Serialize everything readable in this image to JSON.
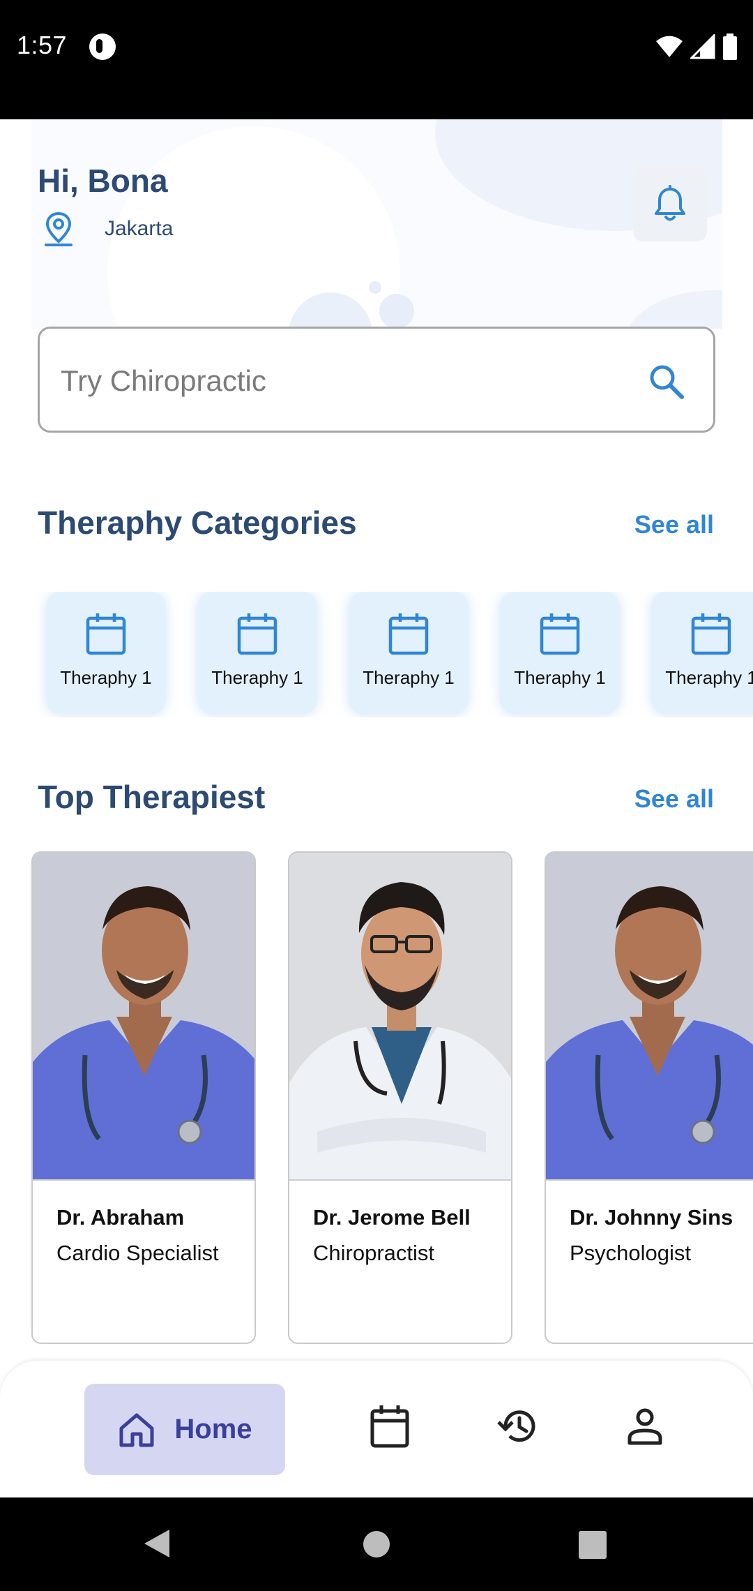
{
  "status_bar": {
    "time": "1:57"
  },
  "header": {
    "greeting": "Hi, Bona",
    "location": "Jakarta"
  },
  "search": {
    "placeholder": "Try Chiropractic"
  },
  "categories_section": {
    "title": "Theraphy Categories",
    "see_all": "See all",
    "items": [
      {
        "label": "Theraphy 1",
        "icon": "calendar-icon"
      },
      {
        "label": "Theraphy 1",
        "icon": "calendar-icon"
      },
      {
        "label": "Theraphy 1",
        "icon": "calendar-icon"
      },
      {
        "label": "Theraphy 1",
        "icon": "calendar-icon"
      },
      {
        "label": "Theraphy 1",
        "icon": "calendar-icon"
      }
    ]
  },
  "therapists_section": {
    "title": "Top Therapiest",
    "see_all": "See all",
    "doctors": [
      {
        "name": "Dr. Abraham",
        "specialty": "Cardio Specialist"
      },
      {
        "name": "Dr. Jerome Bell",
        "specialty": "Chiropractist"
      },
      {
        "name": "Dr. Johnny Sins",
        "specialty": "Psychologist"
      }
    ]
  },
  "bottom_nav": {
    "items": [
      {
        "label": "Home",
        "icon": "home-icon",
        "active": true
      },
      {
        "label": "",
        "icon": "calendar-icon",
        "active": false
      },
      {
        "label": "",
        "icon": "history-icon",
        "active": false
      },
      {
        "label": "",
        "icon": "profile-icon",
        "active": false
      }
    ]
  },
  "colors": {
    "primary_text": "#2c4a73",
    "accent_blue": "#2f86d6",
    "category_bg": "#e3f1fd",
    "nav_active_bg": "#d5d6f1",
    "nav_active_text": "#3b3f9c"
  }
}
